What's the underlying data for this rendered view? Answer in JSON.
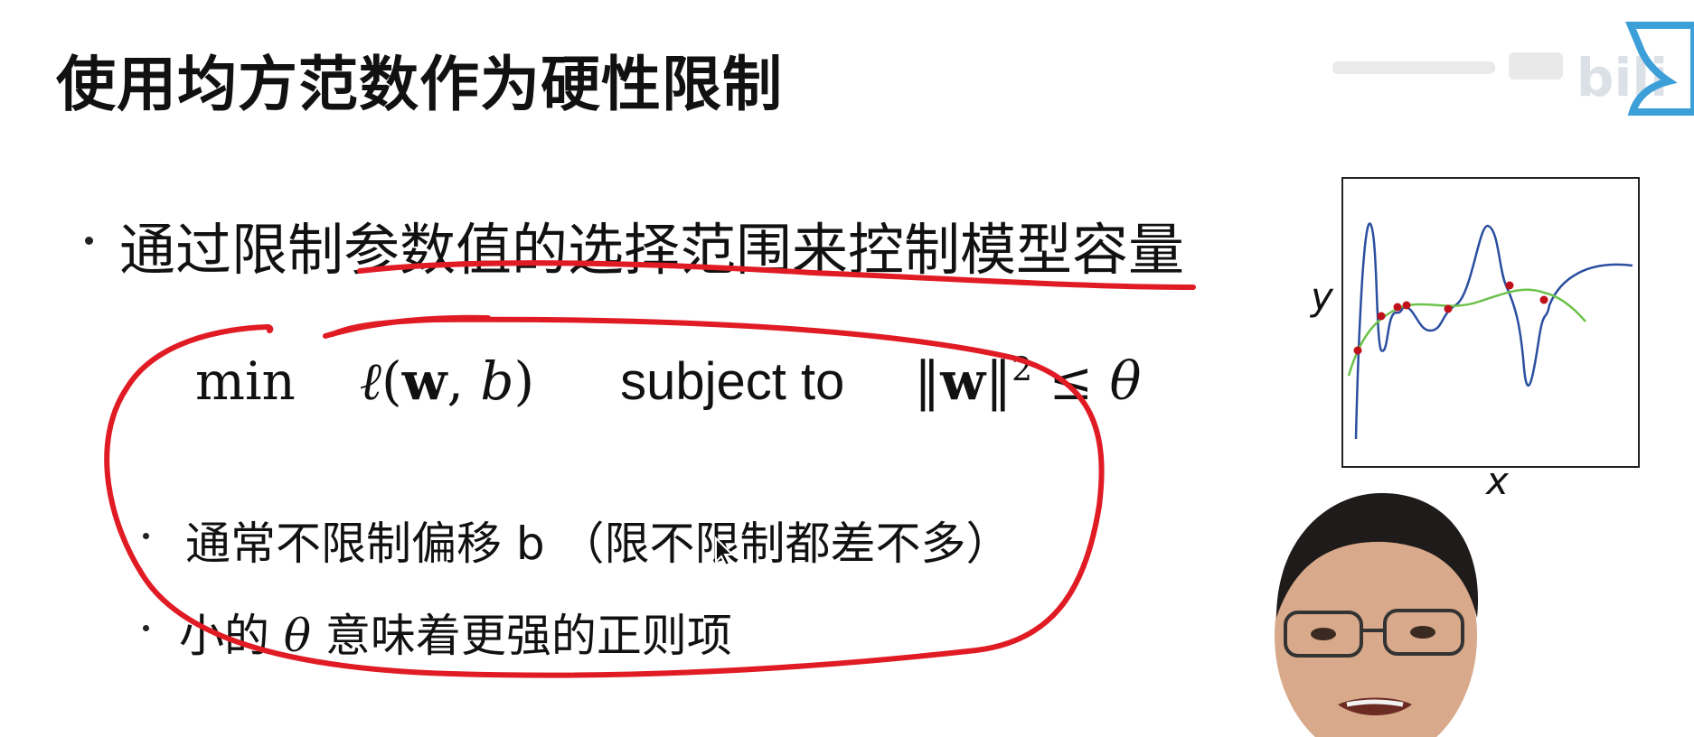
{
  "slide": {
    "title": "使用均方范数作为硬性限制",
    "bullet_main": "通过限制参数值的选择范围来控制模型容量",
    "formula": {
      "min": "min",
      "loss_l": "ℓ",
      "open_paren": "(",
      "w": "w",
      "comma": ",",
      "b": "b",
      "close_paren": ")",
      "subject_to": "subject to",
      "norm_open": "‖",
      "norm_w": "w",
      "norm_close": "‖",
      "exponent": "2",
      "leq": "≤",
      "theta": "θ"
    },
    "sub_bullets": [
      "通常不限制偏移 b （限不限制都差不多）",
      {
        "prefix": "小的",
        "theta": "θ",
        "suffix": "意味着更强的正则项"
      }
    ],
    "graph": {
      "y_label": "y",
      "x_label": "x"
    }
  },
  "colors": {
    "annotation_red": "#e01b24",
    "curve_blue": "#2a4fa0",
    "curve_green": "#6cc24a",
    "point_red": "#c0101a",
    "watermark_blue": "#3c9fd8"
  },
  "icons": [
    "bilibili-logo-icon",
    "cursor-icon",
    "red-point-icon"
  ]
}
